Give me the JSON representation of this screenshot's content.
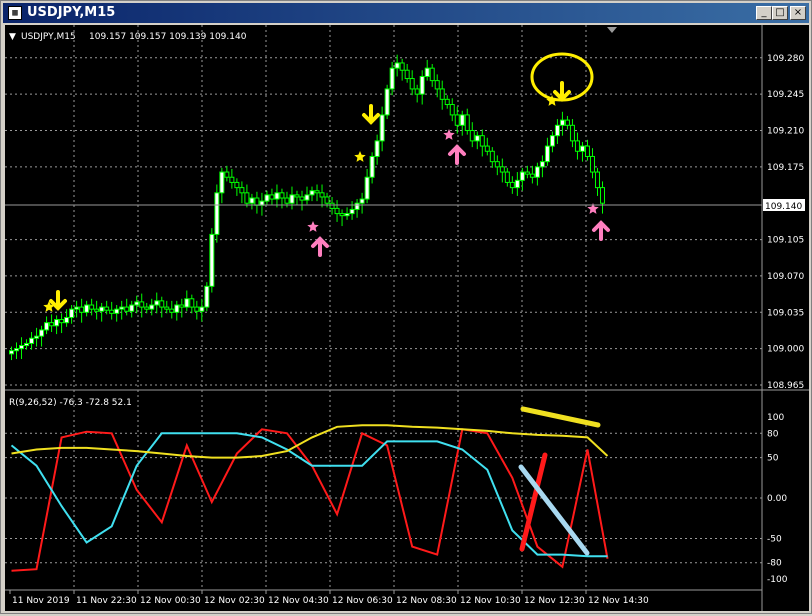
{
  "window": {
    "title": "USDJPY,M15",
    "icon_glyph": "▦",
    "buttons": {
      "minimize": "_",
      "maximize": "□",
      "close": "×"
    }
  },
  "colors": {
    "background": "#000000",
    "grid": "#9a9a9a",
    "axis_text": "#ffffff",
    "candle": "#00ff00",
    "bull_fill": "#ffffff",
    "bear_fill": "#000000",
    "series_r1": "#ff1a1a",
    "series_r2": "#40e0f0",
    "series_r3": "#f0e020",
    "arrow_down": "#ffee00",
    "arrow_up": "#ff7fbf",
    "star_yellow": "#ffee00",
    "star_pink": "#ff7fbf"
  },
  "chart_data": [
    {
      "type": "candlestick",
      "label": "USDJPY,M15  109.157 109.157 109.139 109.140",
      "symbol": "USDJPY,M15",
      "ohlc_label": "109.157 109.157 109.139 109.140",
      "current_price": "109.140",
      "y_ticks": [
        "109.280",
        "109.245",
        "109.210",
        "109.175",
        "109.105",
        "109.070",
        "109.035",
        "109.000",
        "108.965"
      ],
      "ylim": [
        108.965,
        109.3
      ],
      "x_ticks": [
        "11 Nov 2019",
        "11 Nov 22:30",
        "12 Nov 00:30",
        "12 Nov 02:30",
        "12 Nov 04:30",
        "12 Nov 06:30",
        "12 Nov 08:30",
        "12 Nov 10:30",
        "12 Nov 12:30",
        "12 Nov 14:30"
      ],
      "close": [
        108.998,
        109.0,
        109.003,
        109.005,
        109.01,
        109.012,
        109.018,
        109.025,
        109.022,
        109.028,
        109.025,
        109.03,
        109.038,
        109.04,
        109.035,
        109.042,
        109.038,
        109.036,
        109.04,
        109.037,
        109.034,
        109.038,
        109.04,
        109.036,
        109.042,
        109.045,
        109.04,
        109.038,
        109.042,
        109.046,
        109.04,
        109.038,
        109.035,
        109.042,
        109.04,
        109.048,
        109.04,
        109.036,
        109.04,
        109.06,
        109.11,
        109.15,
        109.17,
        109.165,
        109.16,
        109.155,
        109.15,
        109.14,
        109.145,
        109.138,
        109.142,
        109.148,
        109.144,
        109.15,
        109.145,
        109.14,
        109.148,
        109.146,
        109.143,
        109.148,
        109.152,
        109.15,
        109.146,
        109.14,
        109.135,
        109.13,
        109.128,
        109.13,
        109.134,
        109.14,
        109.144,
        109.165,
        109.185,
        109.2,
        109.225,
        109.25,
        109.27,
        109.275,
        109.268,
        109.26,
        109.25,
        109.245,
        109.262,
        109.27,
        109.258,
        109.25,
        109.24,
        109.235,
        109.225,
        109.215,
        109.225,
        109.21,
        109.2,
        109.205,
        109.195,
        109.19,
        109.18,
        109.175,
        109.17,
        109.16,
        109.155,
        109.162,
        109.17,
        109.168,
        109.165,
        109.175,
        109.18,
        109.195,
        109.205,
        109.215,
        109.22,
        109.215,
        109.2,
        109.19,
        109.195,
        109.185,
        109.17,
        109.155,
        109.14
      ],
      "indicator": {
        "label": "R(9,26,52) -76.3 -72.8 52.1",
        "y_ticks": [
          "100",
          "80",
          "50",
          "0.00",
          "-50",
          "-80",
          "-100"
        ],
        "ylim": [
          -110,
          115
        ],
        "x_times": [
          0,
          5,
          10,
          15,
          20,
          25,
          30,
          35,
          40,
          45,
          50,
          55,
          60,
          65,
          70,
          75,
          80,
          85,
          90,
          95,
          100,
          105,
          110,
          115,
          119
        ],
        "series": [
          {
            "name": "R9",
            "values": [
              -90,
              -88,
              75,
              82,
              80,
              10,
              -30,
              65,
              -5,
              55,
              85,
              80,
              40,
              -20,
              80,
              65,
              -60,
              -70,
              85,
              80,
              25,
              -60,
              -85,
              60,
              -75
            ]
          },
          {
            "name": "R26",
            "values": [
              65,
              40,
              -10,
              -55,
              -35,
              40,
              80,
              80,
              80,
              80,
              75,
              60,
              40,
              40,
              40,
              70,
              70,
              70,
              60,
              35,
              -40,
              -70,
              -70,
              -72,
              -72
            ]
          },
          {
            "name": "R52",
            "values": [
              55,
              60,
              62,
              62,
              60,
              58,
              55,
              52,
              50,
              50,
              52,
              58,
              75,
              88,
              90,
              90,
              88,
              87,
              85,
              83,
              80,
              78,
              77,
              75,
              52
            ]
          }
        ]
      }
    }
  ]
}
